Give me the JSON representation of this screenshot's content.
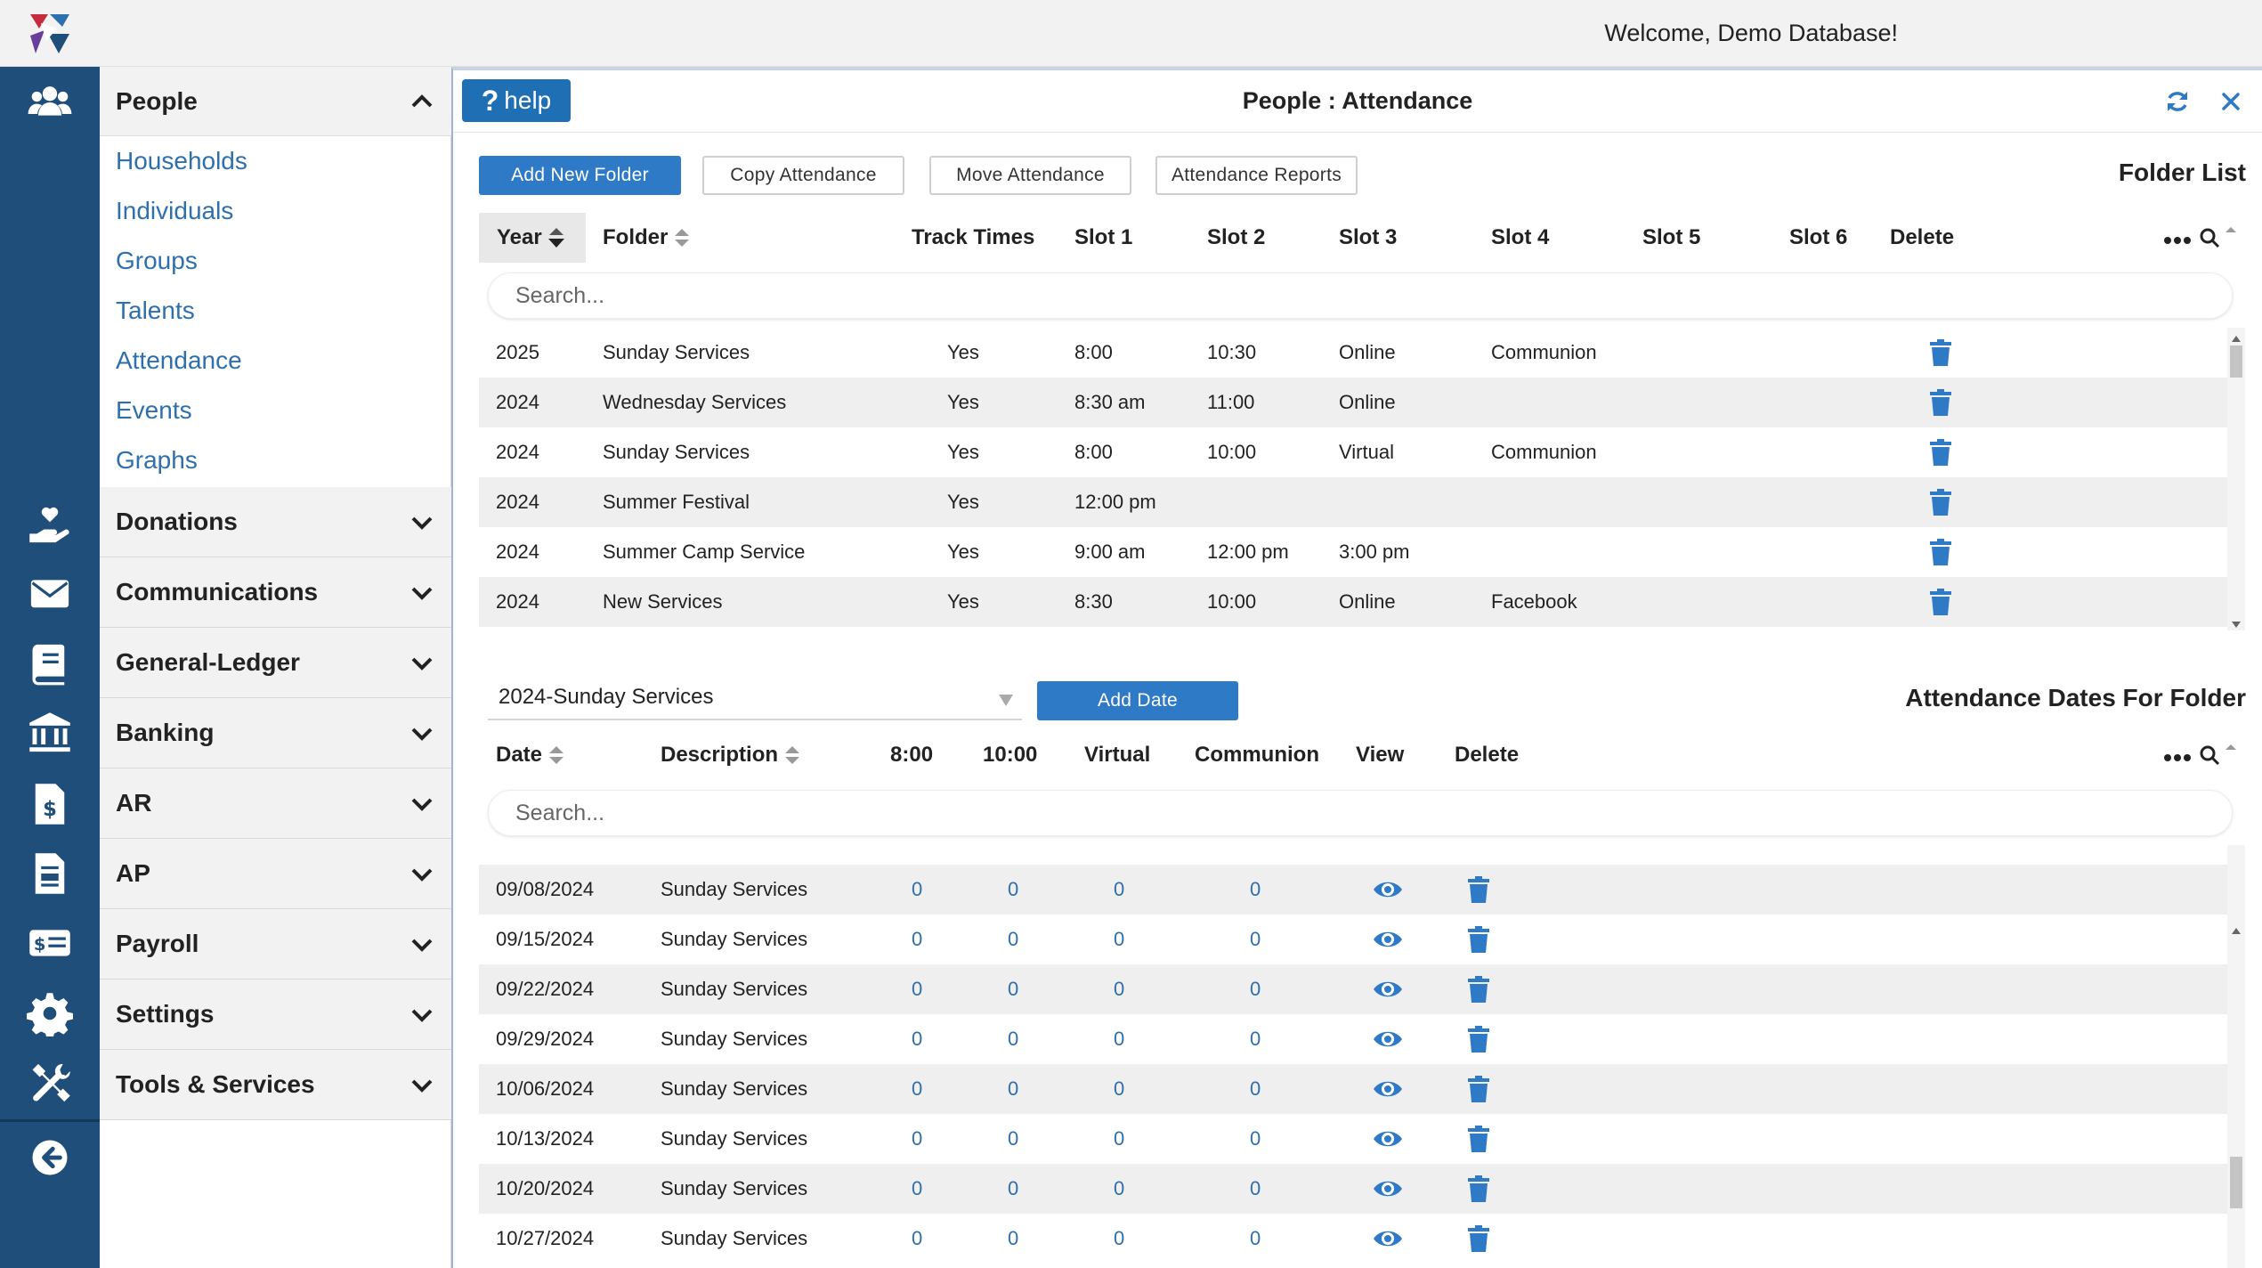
{
  "header": {
    "welcome": "Welcome, Demo Database!"
  },
  "sidebar": {
    "people_label": "People",
    "people_items": [
      "Households",
      "Individuals",
      "Groups",
      "Talents",
      "Attendance",
      "Events",
      "Graphs"
    ],
    "categories": [
      "Donations",
      "Communications",
      "General-Ledger",
      "Banking",
      "AR",
      "AP",
      "Payroll",
      "Settings",
      "Tools & Services"
    ]
  },
  "panel": {
    "help_label": "help",
    "title": "People : Attendance"
  },
  "toolbar": {
    "add_folder": "Add New Folder",
    "copy_attendance": "Copy Attendance",
    "move_attendance": "Move Attendance",
    "attendance_reports": "Attendance Reports"
  },
  "folder_list": {
    "title": "Folder List",
    "columns": [
      "Year",
      "Folder",
      "Track Times",
      "Slot 1",
      "Slot 2",
      "Slot 3",
      "Slot 4",
      "Slot 5",
      "Slot 6",
      "Delete"
    ],
    "search_placeholder": "Search...",
    "rows": [
      {
        "year": "2025",
        "folder": "Sunday Services",
        "track": "Yes",
        "s1": "8:00",
        "s2": "10:30",
        "s3": "Online",
        "s4": "Communion"
      },
      {
        "year": "2024",
        "folder": "Wednesday Services",
        "track": "Yes",
        "s1": "8:30 am",
        "s2": "11:00",
        "s3": "Online",
        "s4": ""
      },
      {
        "year": "2024",
        "folder": "Sunday Services",
        "track": "Yes",
        "s1": "8:00",
        "s2": "10:00",
        "s3": "Virtual",
        "s4": "Communion"
      },
      {
        "year": "2024",
        "folder": "Summer Festival",
        "track": "Yes",
        "s1": "12:00 pm",
        "s2": "",
        "s3": "",
        "s4": ""
      },
      {
        "year": "2024",
        "folder": "Summer Camp Service",
        "track": "Yes",
        "s1": "9:00 am",
        "s2": "12:00 pm",
        "s3": "3:00 pm",
        "s4": ""
      },
      {
        "year": "2024",
        "folder": "New Services",
        "track": "Yes",
        "s1": "8:30",
        "s2": "10:00",
        "s3": "Online",
        "s4": "Facebook"
      }
    ]
  },
  "dates": {
    "selected_folder": "2024-Sunday Services",
    "add_date": "Add Date",
    "title": "Attendance Dates For Folder",
    "columns": [
      "Date",
      "Description",
      "8:00",
      "10:00",
      "Virtual",
      "Communion",
      "View",
      "Delete"
    ],
    "search_placeholder": "Search...",
    "rows": [
      {
        "date": "09/08/2024",
        "desc": "Sunday Services",
        "c1": "0",
        "c2": "0",
        "c3": "0",
        "c4": "0"
      },
      {
        "date": "09/15/2024",
        "desc": "Sunday Services",
        "c1": "0",
        "c2": "0",
        "c3": "0",
        "c4": "0"
      },
      {
        "date": "09/22/2024",
        "desc": "Sunday Services",
        "c1": "0",
        "c2": "0",
        "c3": "0",
        "c4": "0"
      },
      {
        "date": "09/29/2024",
        "desc": "Sunday Services",
        "c1": "0",
        "c2": "0",
        "c3": "0",
        "c4": "0"
      },
      {
        "date": "10/06/2024",
        "desc": "Sunday Services",
        "c1": "0",
        "c2": "0",
        "c3": "0",
        "c4": "0"
      },
      {
        "date": "10/13/2024",
        "desc": "Sunday Services",
        "c1": "0",
        "c2": "0",
        "c3": "0",
        "c4": "0"
      },
      {
        "date": "10/20/2024",
        "desc": "Sunday Services",
        "c1": "0",
        "c2": "0",
        "c3": "0",
        "c4": "0"
      },
      {
        "date": "10/27/2024",
        "desc": "Sunday Services",
        "c1": "0",
        "c2": "0",
        "c3": "0",
        "c4": "0"
      }
    ]
  },
  "icons": {
    "rail": [
      "people-icon",
      "donation-hand-icon",
      "envelope-icon",
      "ledger-book-icon",
      "bank-icon",
      "invoice-dollar-icon",
      "ap-document-icon",
      "payroll-money-icon",
      "gear-icon",
      "tools-icon",
      "back-arrow-icon"
    ]
  },
  "colors": {
    "rail": "#1e4e79",
    "accent": "#2f7ac6",
    "link": "#2e6fad"
  }
}
